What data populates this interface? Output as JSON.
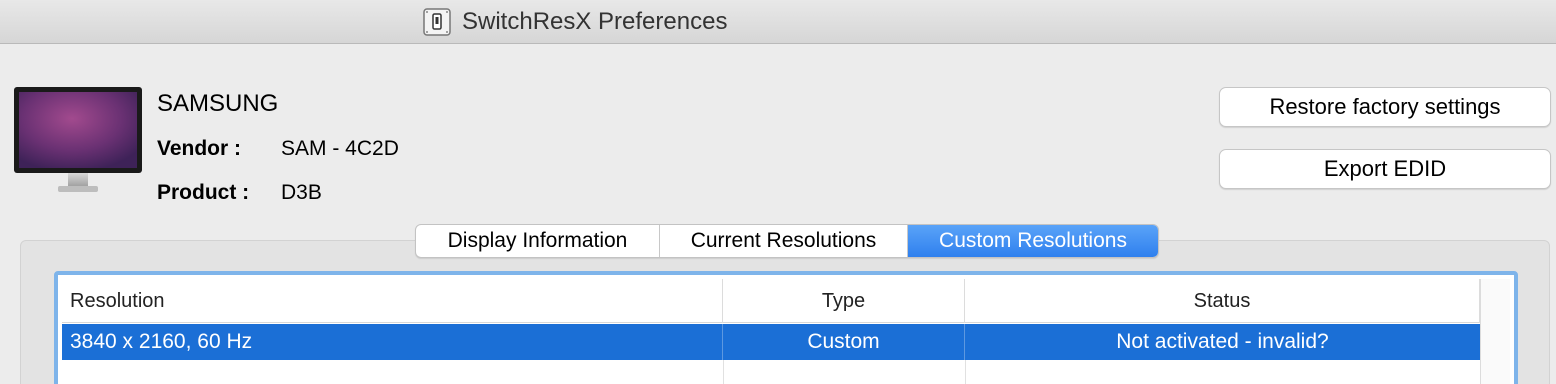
{
  "window": {
    "title": "SwitchResX Preferences"
  },
  "display": {
    "name": "SAMSUNG",
    "vendor_label": "Vendor :",
    "vendor_value": "SAM - 4C2D",
    "product_label": "Product :",
    "product_value": "D3B"
  },
  "actions": {
    "restore_label": "Restore factory settings",
    "export_label": "Export EDID"
  },
  "tabs": [
    {
      "label": "Display Information",
      "active": false
    },
    {
      "label": "Current Resolutions",
      "active": false
    },
    {
      "label": "Custom Resolutions",
      "active": true
    }
  ],
  "table": {
    "columns": [
      "Resolution",
      "Type",
      "Status"
    ],
    "rows": [
      {
        "resolution": "3840 x 2160, 60 Hz",
        "type": "Custom",
        "status": "Not activated - invalid?",
        "selected": true
      }
    ]
  },
  "colors": {
    "accent": "#1b6fd6",
    "tab_active": "#3d8ef4"
  }
}
